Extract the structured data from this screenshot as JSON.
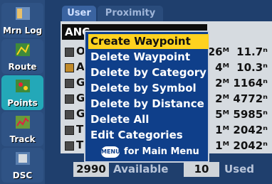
{
  "nav": {
    "items": [
      {
        "label": "Mrn Log",
        "icon": "logbook-icon"
      },
      {
        "label": "Route",
        "icon": "route-icon"
      },
      {
        "label": "Points",
        "icon": "points-icon",
        "active": true
      },
      {
        "label": "Track",
        "icon": "track-icon"
      },
      {
        "label": "DSC",
        "icon": "dsc-icon"
      }
    ]
  },
  "tabs": [
    {
      "label": "User",
      "active": true
    },
    {
      "label": "Proximity",
      "active": false
    }
  ],
  "list": {
    "header_partial": "ANC",
    "rows": [
      {
        "init": "O",
        "dist": "26ᴹ",
        "elev": "11.7ⁿ"
      },
      {
        "init": "Al",
        "dist": "4ᴹ",
        "elev": "10.3ⁿ"
      },
      {
        "init": "G",
        "dist": "2ᴹ",
        "elev": "1164ⁿ"
      },
      {
        "init": "G",
        "dist": "2ᴹ",
        "elev": "4772ⁿ"
      },
      {
        "init": "G",
        "dist": "5ᴹ",
        "elev": "5985ⁿ"
      },
      {
        "init": "T",
        "dist": "1ᴹ",
        "elev": "2042ⁿ"
      },
      {
        "init": "T",
        "dist": "1ᴹ",
        "elev": "2042ⁿ"
      }
    ]
  },
  "menu": {
    "items": [
      {
        "label": "Create Waypoint",
        "selected": true
      },
      {
        "label": "Delete Waypoint"
      },
      {
        "label": "Delete by Category"
      },
      {
        "label": "Delete by Symbol"
      },
      {
        "label": "Delete by Distance"
      },
      {
        "label": "Delete All"
      },
      {
        "label": "Edit Categories"
      }
    ],
    "footer_button": "MENU",
    "footer_text": "for Main Menu"
  },
  "footer": {
    "available_count": "2990",
    "available_label": "Available",
    "used_count": "10",
    "used_label": "Used"
  },
  "colors": {
    "rail": "#2a4c7c",
    "active_nav": "#23a8b8",
    "menu_bg": "#0f3f8a",
    "menu_selected": "#ffd21f"
  }
}
